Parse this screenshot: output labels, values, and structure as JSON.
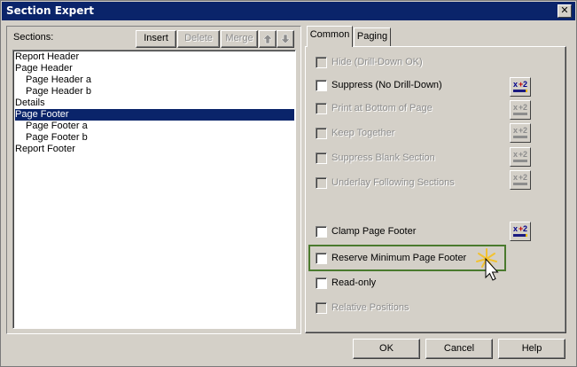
{
  "window": {
    "title": "Section Expert",
    "close_glyph": "✕"
  },
  "sections_panel": {
    "label": "Sections:",
    "insert_label": "Insert",
    "delete_label": "Delete",
    "merge_label": "Merge",
    "up_icon": "arrow-up-icon",
    "down_icon": "arrow-down-icon",
    "items": [
      {
        "label": "Report Header",
        "indent": 0,
        "selected": false
      },
      {
        "label": "Page Header",
        "indent": 0,
        "selected": false
      },
      {
        "label": "Page Header a",
        "indent": 1,
        "selected": false
      },
      {
        "label": "Page Header b",
        "indent": 1,
        "selected": false
      },
      {
        "label": "Details",
        "indent": 0,
        "selected": false
      },
      {
        "label": "Page Footer",
        "indent": 0,
        "selected": true
      },
      {
        "label": "Page Footer a",
        "indent": 1,
        "selected": false
      },
      {
        "label": "Page Footer b",
        "indent": 1,
        "selected": false
      },
      {
        "label": "Report Footer",
        "indent": 0,
        "selected": false
      }
    ]
  },
  "tabs": [
    {
      "label": "Common",
      "active": true
    },
    {
      "label": "Paging",
      "active": false
    }
  ],
  "options": [
    {
      "label": "Hide (Drill-Down OK)",
      "enabled": false,
      "checked": false,
      "formula": null
    },
    {
      "label": "Suppress (No Drill-Down)",
      "enabled": true,
      "checked": false,
      "formula": "active"
    },
    {
      "label": "Print at Bottom of Page",
      "enabled": false,
      "checked": false,
      "formula": "inactive"
    },
    {
      "label": "Keep Together",
      "enabled": false,
      "checked": false,
      "formula": "inactive"
    },
    {
      "label": "Suppress Blank Section",
      "enabled": false,
      "checked": false,
      "formula": "inactive"
    },
    {
      "label": "Underlay Following Sections",
      "enabled": false,
      "checked": false,
      "formula": "inactive"
    },
    {
      "label": "Clamp Page Footer",
      "enabled": true,
      "checked": false,
      "formula": "active"
    },
    {
      "label": "Reserve Minimum Page Footer",
      "enabled": true,
      "checked": false,
      "formula": null
    },
    {
      "label": "Read-only",
      "enabled": true,
      "checked": false,
      "formula": null
    },
    {
      "label": "Relative Positions",
      "enabled": false,
      "checked": false,
      "formula": null
    }
  ],
  "footer": {
    "ok_label": "OK",
    "cancel_label": "Cancel",
    "help_label": "Help"
  },
  "colors": {
    "selection": "#0a246a",
    "highlight_border": "#4a7a2e",
    "face": "#d4d0c8"
  }
}
